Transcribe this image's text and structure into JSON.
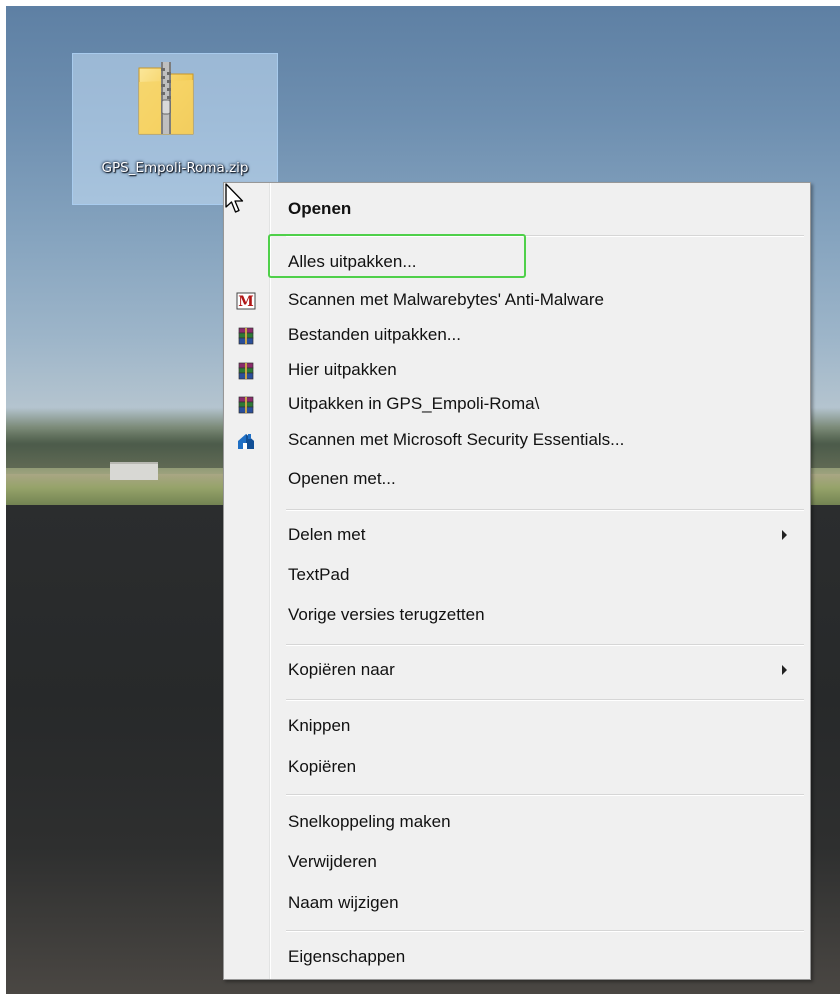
{
  "desktop": {
    "file": {
      "name": "GPS_Empoli-Roma.zip",
      "icon": "zip-folder-icon"
    }
  },
  "context_menu": {
    "items": [
      {
        "label": "Openen",
        "bold": true
      },
      {
        "label": "Alles uitpakken...",
        "highlighted": true
      },
      {
        "label": "Scannen met Malwarebytes' Anti-Malware",
        "icon": "malwarebytes-icon"
      },
      {
        "label": "Bestanden uitpakken...",
        "icon": "winrar-icon"
      },
      {
        "label": "Hier uitpakken",
        "icon": "winrar-icon"
      },
      {
        "label": "Uitpakken in GPS_Empoli-Roma\\",
        "icon": "winrar-icon"
      },
      {
        "label": "Scannen met Microsoft Security Essentials...",
        "icon": "microsoft-security-essentials-icon"
      },
      {
        "label": "Openen met..."
      },
      {
        "label": "Delen met",
        "submenu": true
      },
      {
        "label": "TextPad"
      },
      {
        "label": "Vorige versies terugzetten"
      },
      {
        "label": "Kopiëren naar",
        "submenu": true
      },
      {
        "label": "Knippen"
      },
      {
        "label": "Kopiëren"
      },
      {
        "label": "Snelkoppeling maken"
      },
      {
        "label": "Verwijderen"
      },
      {
        "label": "Naam wijzigen"
      },
      {
        "label": "Eigenschappen"
      }
    ]
  },
  "colors": {
    "highlight_border": "#4fd04a",
    "menu_background": "#f0f0f0"
  }
}
